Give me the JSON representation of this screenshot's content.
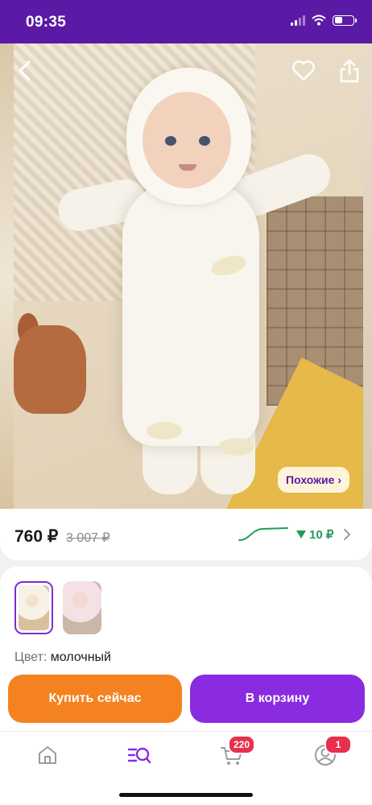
{
  "status_bar": {
    "time": "09:35",
    "icons": [
      "cellular-signal-icon",
      "wifi-icon",
      "battery-icon"
    ]
  },
  "product": {
    "image_icons": [
      "back-arrow-icon",
      "heart-icon",
      "share-icon"
    ],
    "similar_label": "Похожие ›"
  },
  "price": {
    "current": "760 ₽",
    "old": "3 007 ₽",
    "drop": "10 ₽",
    "trend_color": "#1f9d5a"
  },
  "variants": {
    "thumbnails": [
      "variant-milky",
      "variant-pink"
    ],
    "selected_index": 0,
    "color_label": "Цвет:",
    "color_value": "молочный"
  },
  "actions": {
    "buy_now": "Купить сейчас",
    "add_to_cart": "В корзину",
    "buy_color": "#f58220",
    "cart_color": "#8a2be2"
  },
  "tab_bar": {
    "items": [
      {
        "icon": "home-icon"
      },
      {
        "icon": "catalog-search-icon",
        "active": true
      },
      {
        "icon": "cart-icon",
        "badge": "220"
      },
      {
        "icon": "profile-icon",
        "badge": "1"
      }
    ],
    "accent": "#8a2be2"
  }
}
